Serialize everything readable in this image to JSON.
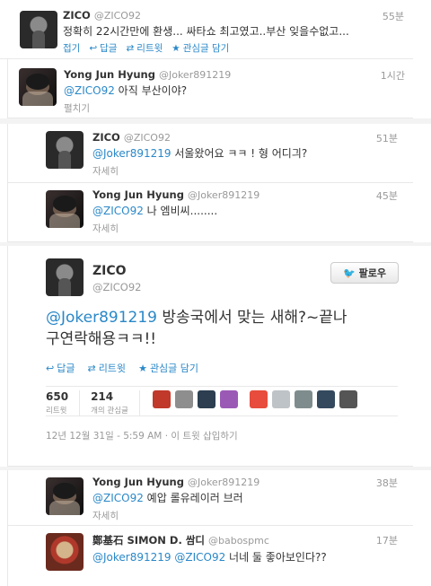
{
  "tweets": {
    "t1": {
      "name": "ZICO",
      "handle": "@ZICO92",
      "time": "55분",
      "text": "정확히 22시간만에 환생... 싸타쇼 최고였고..부산 잊을수없고...",
      "collapse": "접기",
      "reply": "답글",
      "retweet": "리트윗",
      "favorite": "관심글 담기"
    },
    "t2": {
      "name": "Yong Jun Hyung",
      "handle": "@Joker891219",
      "time": "1시간",
      "mention": "@ZICO92",
      "text": " 아직 부산이야?",
      "expand": "펼치기"
    },
    "t3": {
      "name": "ZICO",
      "handle": "@ZICO92",
      "time": "51분",
      "mention": "@Joker891219",
      "text": " 서울왔어요 ㅋㅋ ! 형 어디긔?",
      "details": "자세히"
    },
    "t4": {
      "name": "Yong Jun Hyung",
      "handle": "@Joker891219",
      "time": "45분",
      "mention": "@ZICO92",
      "text": " 나 엠비씨........",
      "details": "자세히"
    },
    "main": {
      "name": "ZICO",
      "handle": "@ZICO92",
      "follow": "팔로우",
      "mention": "@Joker891219",
      "text_line1": " 방송국에서 맞는 새해?~끝나",
      "text_line2": "구연락해용ㅋㅋ!!",
      "reply": "답글",
      "retweet": "리트윗",
      "favorite": "관심글 담기",
      "retweets_count": "650",
      "retweets_label": "리트윗",
      "favorites_count": "214",
      "favorites_label": "개의 관심글",
      "timestamp": "12년 12월 31일 - 5:59 AM",
      "embed": "이 트윗 삽입하기"
    },
    "t5": {
      "name": "Yong Jun Hyung",
      "handle": "@Joker891219",
      "time": "38분",
      "mention": "@ZICO92",
      "text": " 예압 롤유레이러 브러",
      "details": "자세히"
    },
    "t6": {
      "name": "鄭基石 SIMON D. 쌈디",
      "handle": "@babospmc",
      "time": "17분",
      "mention1": "@Joker891219",
      "mention2": "@ZICO92",
      "text": " 너네 둘 좋아보인다??"
    }
  },
  "colors": {
    "link": "#2a88c8",
    "meta": "#999999",
    "text": "#333333"
  },
  "favoriter_avatar_colors": [
    "#c0392b",
    "#8e8e8e",
    "#2c3e50",
    "#9b59b6",
    "#e74c3c",
    "#bdc3c7",
    "#7f8c8d",
    "#34495e",
    "#555555"
  ]
}
